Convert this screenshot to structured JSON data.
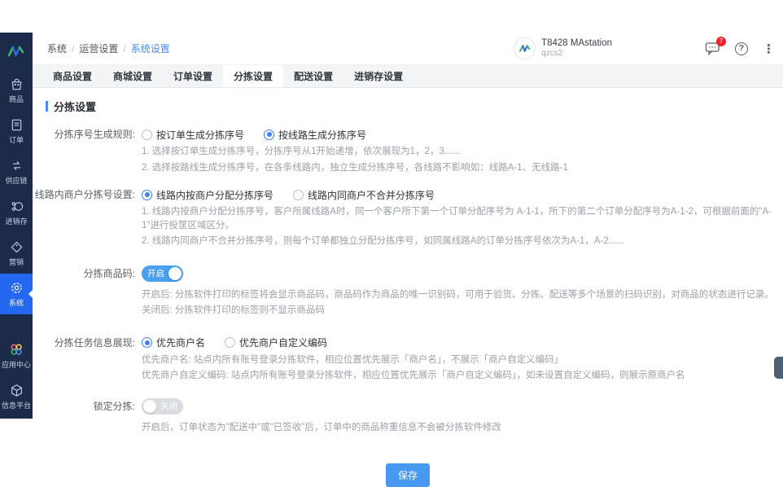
{
  "colors": {
    "sidebar_bg": "#1c2b4a",
    "active_item_blue": "#2468f2",
    "accent_blue": "#4798f0",
    "link_blue": "#4a8bf0",
    "badge_red": "#f5222d"
  },
  "sidebar": {
    "items": [
      {
        "label": "商品",
        "icon": "bag-icon"
      },
      {
        "label": "订单",
        "icon": "order-icon"
      },
      {
        "label": "供应链",
        "icon": "supply-chain-icon"
      },
      {
        "label": "进销存",
        "icon": "inventory-icon"
      },
      {
        "label": "营销",
        "icon": "tag-icon"
      },
      {
        "label": "系统",
        "icon": "gear-icon",
        "active": true
      },
      {
        "label": "应用中心",
        "icon": "apps-icon"
      },
      {
        "label": "信息平台",
        "icon": "cube-icon"
      }
    ]
  },
  "header": {
    "breadcrumb": {
      "items": [
        "系统",
        "运营设置",
        "系统设置"
      ],
      "separator": "/"
    },
    "account": {
      "name": "T8428 MAstation",
      "sub": "qzcs2"
    },
    "message_badge": "7",
    "icons": {
      "help_glyph": "?",
      "more_glyph": "⋮"
    }
  },
  "tabs": {
    "items": [
      "商品设置",
      "商城设置",
      "订单设置",
      "分拣设置",
      "配送设置",
      "进销存设置"
    ],
    "active": "分拣设置"
  },
  "section": {
    "title": "分拣设置"
  },
  "form": {
    "rows": [
      {
        "label": "分拣序号生成规则:",
        "type": "radio",
        "options": [
          {
            "text": "按订单生成分拣序号",
            "checked": false
          },
          {
            "text": "按线路生成分拣序号",
            "checked": true
          }
        ],
        "help": [
          "1. 选择按订单生成分拣序号，分拣序号从1开始递增，依次展现为1，2，3......",
          "2. 选择按路线生成分拣序号，在各条线路内，独立生成分拣序号，各线路不影响如：线路A-1、无线路-1"
        ]
      },
      {
        "label": "线路内商户分拣号设置:",
        "type": "radio",
        "options": [
          {
            "text": "线路内按商户分配分拣序号",
            "checked": true
          },
          {
            "text": "线路内同商户不合并分拣序号",
            "checked": false
          }
        ],
        "help": [
          "1. 线路内按商户分配分拣序号，客户所属线路A时，同一个客户所下第一个订单分配序号为 A-1-1，所下的第二个订单分配序号为A-1-2，可根据前面的\"A-1\"进行投筐区域区分。",
          "2. 线路内同商户不合并分拣序号，则每个订单都独立分配分拣序号，如同属线路A的订单分拣序号依次为A-1，A-2......"
        ]
      },
      {
        "label": "分拣商品码:",
        "type": "toggle",
        "toggle": {
          "on": true,
          "text": "开启"
        },
        "help": [
          "开启后: 分拣软件打印的标签将会显示商品码，商品码作为商品的唯一识别码，可用于验货、分拣、配送等多个场景的扫码识别，对商品的状态进行记录。",
          "关闭后: 分拣软件打印的标签则不显示商品码"
        ]
      },
      {
        "label": "分拣任务信息展现:",
        "type": "radio",
        "options": [
          {
            "text": "优先商户名",
            "checked": true
          },
          {
            "text": "优先商户自定义编码",
            "checked": false
          }
        ],
        "help": [
          "优先商户名: 站点内所有账号登录分拣软件，相应位置优先展示「商户名」，不展示「商户自定义编码」",
          "优先商户自定义编码: 站点内所有账号登录分拣软件，相应位置优先展示「商户自定义编码」，如未设置自定义编码，则展示原商户名"
        ]
      },
      {
        "label": "锁定分拣:",
        "type": "toggle",
        "toggle": {
          "on": false,
          "text": "关闭"
        },
        "help": [
          "开启后，订单状态为\"配送中\"或\"已签收\"后，订单中的商品称重信息不会被分拣软件修改"
        ]
      }
    ],
    "save_label": "保存"
  }
}
